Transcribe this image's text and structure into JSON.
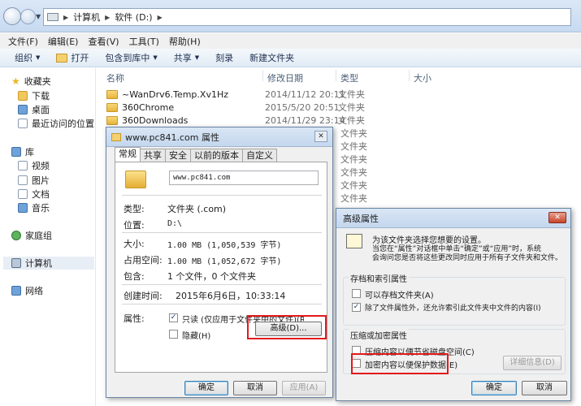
{
  "address": {
    "segments": [
      "计算机",
      "软件 (D:)"
    ]
  },
  "menu": [
    "文件(F)",
    "编辑(E)",
    "查看(V)",
    "工具(T)",
    "帮助(H)"
  ],
  "toolbar": {
    "organize": "组织",
    "open": "打开",
    "include_library": "包含到库中",
    "share": "共享",
    "burn": "刻录",
    "new_folder": "新建文件夹"
  },
  "navpane": {
    "favorites": "收藏夹",
    "downloads": "下载",
    "desktop": "桌面",
    "recent": "最近访问的位置",
    "libraries": "库",
    "videos": "视频",
    "pictures": "图片",
    "documents": "文档",
    "music": "音乐",
    "homegroup": "家庭组",
    "computer": "计算机",
    "network": "网络"
  },
  "columns": {
    "name": "名称",
    "date": "修改日期",
    "type": "类型",
    "size": "大小"
  },
  "files": [
    {
      "name": "~WanDrv6.Temp.Xv1Hz",
      "date": "2014/11/12 20:11",
      "type": "文件夹"
    },
    {
      "name": "360Chrome",
      "date": "2015/5/20 20:51",
      "type": "文件夹"
    },
    {
      "name": "360Downloads",
      "date": "2014/11/29 23:14",
      "type": "文件夹"
    }
  ],
  "extra_type_label": "文件夹",
  "props": {
    "title": "www.pc841.com 属性",
    "tabs": [
      "常规",
      "共享",
      "安全",
      "以前的版本",
      "自定义"
    ],
    "name_value": "www.pc841.com",
    "type_label": "类型:",
    "type_value": "文件夹 (.com)",
    "location_label": "位置:",
    "location_value": "D:\\",
    "size_label": "大小:",
    "size_value": "1.00 MB (1,050,539 字节)",
    "disk_size_label": "占用空间:",
    "disk_size_value": "1.00 MB (1,052,672 字节)",
    "contains_label": "包含:",
    "contains_value": "1 个文件，0 个文件夹",
    "created_label": "创建时间:",
    "created_value": "2015年6月6日，10:33:14",
    "attributes_label": "属性:",
    "readonly_label": "只读 (仅应用于文件夹中的文件)(R)",
    "hidden_label": "隐藏(H)",
    "advanced_button": "高级(D)...",
    "ok": "确定",
    "cancel": "取消",
    "apply": "应用(A)"
  },
  "adv": {
    "title": "高级属性",
    "desc1": "为该文件夹选择您想要的设置。",
    "desc2": "当您在“属性”对话框中单击“确定”或“应用”时，系统",
    "desc3": "会询问您是否将这些更改同时应用于所有子文件夹和文件。",
    "archive_group": "存档和索引属性",
    "archive_label": "可以存档文件夹(A)",
    "index_label": "除了文件属性外，还允许索引此文件夹中文件的内容(I)",
    "compress_group": "压缩或加密属性",
    "compress_label": "压缩内容以便节省磁盘空间(C)",
    "encrypt_label": "加密内容以便保护数据(E)",
    "details_button": "详细信息(D)",
    "ok": "确定",
    "cancel": "取消",
    "close_glyph": "✕"
  },
  "glyphs": {
    "check": "✓",
    "caret": "▼",
    "sep": "▶",
    "close": "✕"
  },
  "colors": {
    "highlight_red": "#e3191c",
    "folder_yellow": "#f0c85c"
  }
}
